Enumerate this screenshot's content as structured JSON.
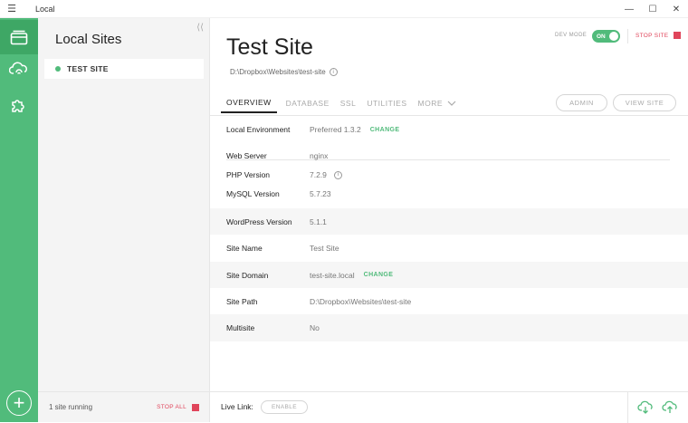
{
  "window": {
    "title": "Local",
    "menu_icon": "hamburger-icon",
    "controls": [
      "minimize",
      "maximize",
      "close"
    ]
  },
  "rail": {
    "items": [
      "sites-icon",
      "cloud-icon",
      "addons-icon"
    ],
    "add_icon": "plus-icon"
  },
  "sites_panel": {
    "title": "Local Sites",
    "collapse_icon": "double-chevron-left-icon",
    "sites": [
      {
        "name": "TEST SITE",
        "status": "running"
      }
    ],
    "footer_status": "1 site running",
    "stop_all_label": "STOP ALL"
  },
  "site": {
    "title": "Test Site",
    "path": "D:\\Dropbox\\Websites\\test-site",
    "dev_mode_label": "DEV MODE",
    "dev_mode_toggle": "ON",
    "stop_site_label": "STOP SITE"
  },
  "tabs": [
    {
      "label": "OVERVIEW",
      "active": true
    },
    {
      "label": "DATABASE",
      "active": false
    },
    {
      "label": "SSL",
      "active": false
    },
    {
      "label": "UTILITIES",
      "active": false
    },
    {
      "label": "MORE",
      "active": false
    }
  ],
  "header_buttons": {
    "admin": "ADMIN",
    "view_site": "VIEW SITE"
  },
  "overview": {
    "local_environment": {
      "label": "Local Environment",
      "value": "Preferred 1.3.2",
      "action": "CHANGE"
    },
    "web_server": {
      "label": "Web Server",
      "value": "nginx"
    },
    "php_version": {
      "label": "PHP Version",
      "value": "7.2.9"
    },
    "mysql_version": {
      "label": "MySQL Version",
      "value": "5.7.23"
    },
    "wordpress_version": {
      "label": "WordPress Version",
      "value": "5.1.1"
    },
    "site_name": {
      "label": "Site Name",
      "value": "Test Site"
    },
    "site_domain": {
      "label": "Site Domain",
      "value": "test-site.local",
      "action": "CHANGE"
    },
    "site_path": {
      "label": "Site Path",
      "value": "D:\\Dropbox\\Websites\\test-site"
    },
    "multisite": {
      "label": "Multisite",
      "value": "No"
    }
  },
  "bottom_bar": {
    "live_link_label": "Live Link:",
    "enable_label": "ENABLE",
    "icons": [
      "cloud-download-icon",
      "cloud-upload-icon"
    ]
  },
  "colors": {
    "accent_green": "#51bb7b",
    "stop_red": "#e0455b"
  }
}
